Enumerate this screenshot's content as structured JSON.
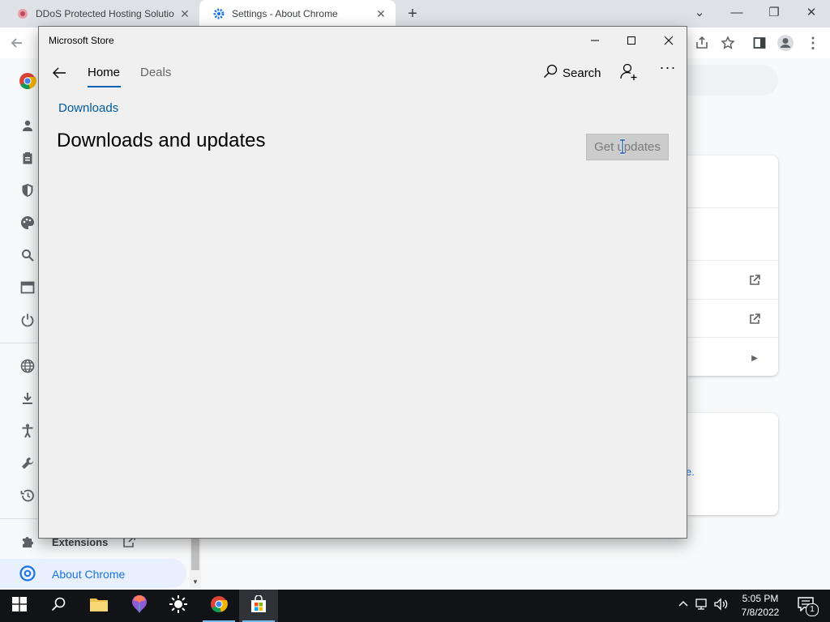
{
  "browser": {
    "tabs": [
      {
        "title": "DDoS Protected Hosting Solutio",
        "favicon": "ddos-site-icon",
        "active": false
      },
      {
        "title": "Settings - About Chrome",
        "favicon": "gear-icon",
        "active": true
      }
    ],
    "new_tab_symbol": "+",
    "window_controls": {
      "dropdown": "⌄",
      "minimize": "—",
      "restore": "❐",
      "close": "✕"
    }
  },
  "settings": {
    "nav_partial": {
      "extensions_label": "Extensions",
      "about_label": "About Chrome"
    },
    "link_fragment": "e."
  },
  "store": {
    "title": "Microsoft Store",
    "tabs": [
      {
        "label": "Home"
      },
      {
        "label": "Deals"
      }
    ],
    "search_label": "Search",
    "more_label": "···",
    "breadcrumb": "Downloads",
    "page_title": "Downloads and updates",
    "get_updates_label": "Get updates",
    "accent_color": "#0063b1"
  },
  "taskbar": {
    "time": "5:05 PM",
    "date": "7/8/2022",
    "notification_count": "1",
    "apps": [
      "start",
      "search",
      "file-explorer",
      "paint-3d",
      "brightness",
      "chrome",
      "microsoft-store"
    ]
  }
}
